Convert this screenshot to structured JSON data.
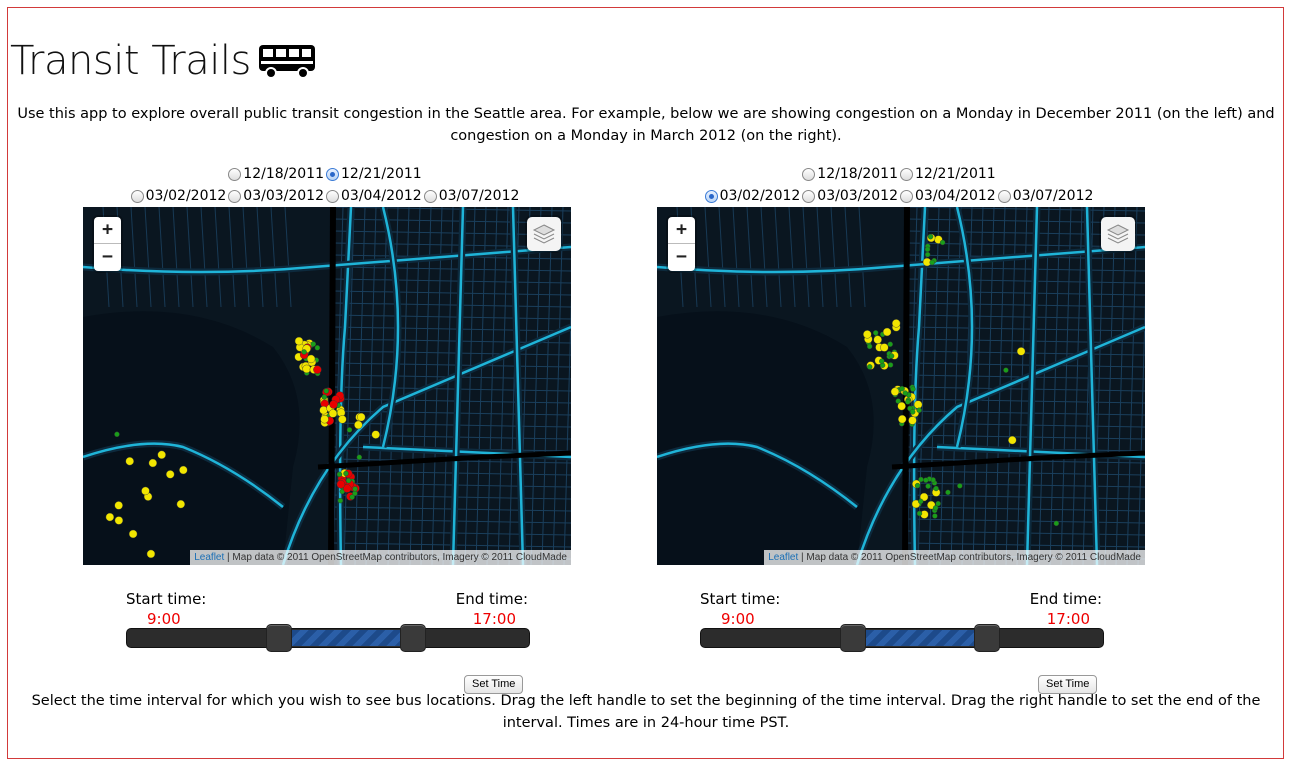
{
  "app": {
    "title": "Transit Trails",
    "intro": "Use this app to explore overall public transit congestion in the Seattle area. For example, below we are showing congestion on a Monday in December 2011 (on the left) and congestion on a Monday in March 2012 (on the right).",
    "footer": "Select the time interval for which you wish to see bus locations. Drag the left handle to set the beginning of the time interval. Drag the right handle to set the end of the interval. Times are in 24-hour time PST."
  },
  "panels": [
    {
      "dates_row1": [
        "12/18/2011",
        "12/21/2011"
      ],
      "dates_row2": [
        "03/02/2012",
        "03/03/2012",
        "03/04/2012",
        "03/07/2012"
      ],
      "selected_date": "12/21/2011",
      "zoom_in": "+",
      "zoom_out": "−",
      "attribution_link": "Leaflet",
      "attribution_text": " | Map data © 2011 OpenStreetMap contributors, Imagery © 2011 CloudMade",
      "start_label": "Start time:",
      "end_label": "End time:",
      "start_time": "9:00",
      "end_time": "17:00",
      "set_time_button": "Set Time"
    },
    {
      "dates_row1": [
        "12/18/2011",
        "12/21/2011"
      ],
      "dates_row2": [
        "03/02/2012",
        "03/03/2012",
        "03/04/2012",
        "03/07/2012"
      ],
      "selected_date": "03/02/2012",
      "zoom_in": "+",
      "zoom_out": "−",
      "attribution_link": "Leaflet",
      "attribution_text": " | Map data © 2011 OpenStreetMap contributors, Imagery © 2011 CloudMade",
      "start_label": "Start time:",
      "end_label": "End time:",
      "start_time": "9:00",
      "end_time": "17:00",
      "set_time_button": "Set Time"
    }
  ],
  "colors": {
    "frame_border": "#d23a3a",
    "time_text": "#e00000",
    "map_bg": "#0a1620",
    "road": "#1fb4d8",
    "congestion_low": "#1a9e1a",
    "congestion_mid": "#f2e600",
    "congestion_high": "#e80000"
  },
  "icons": [
    "bus-icon",
    "layers-icon",
    "radio-icon"
  ]
}
